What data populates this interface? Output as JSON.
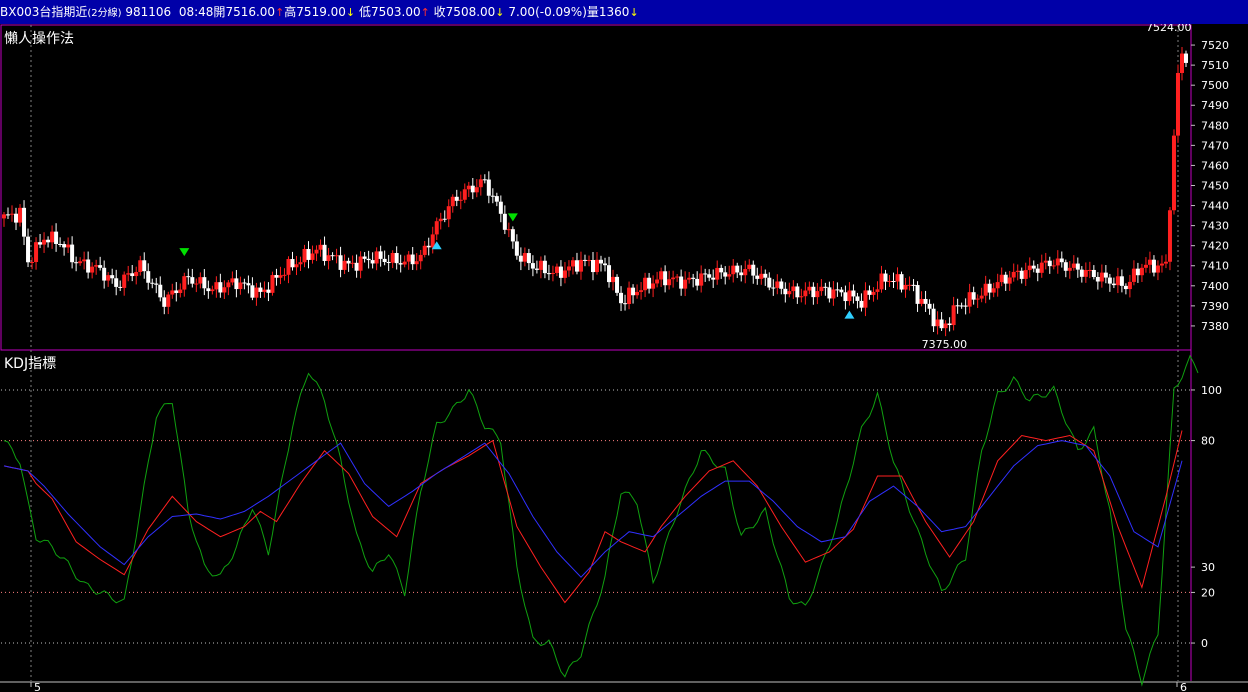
{
  "header": {
    "symbol": "BX003",
    "name": "台指期近",
    "interval": "(2分線)",
    "date": "981106",
    "time": "08:48",
    "open_label": "開",
    "open": "7516.00",
    "high_label": "高",
    "high": "7519.00",
    "low_label": "低",
    "low": "7503.00",
    "close_label": "收",
    "close": "7508.00",
    "change": "7.00",
    "change_pct": "(-0.09%)",
    "volume_label": "量",
    "volume": "1360"
  },
  "colors": {
    "title_bg": "#0000a8",
    "up_candle": "#ff2020",
    "down_candle": "#ffffff",
    "k_line": "#ff2020",
    "d_line": "#3030ff",
    "j_line": "#10a010",
    "panel_border": "#c000c0",
    "buy_marker": "#30d0ff",
    "sell_marker": "#00e000"
  },
  "price_panel": {
    "title": "懶人操作法",
    "high_annotation": "7524.00",
    "low_annotation": "7375.00"
  },
  "kdj_panel": {
    "title": "KDJ指標"
  },
  "x_axis": {
    "labels": [
      "5",
      "6"
    ]
  },
  "chart_data": [
    {
      "type": "candlestick",
      "title": "懶人操作法",
      "ylim": [
        7368,
        7530
      ],
      "y_ticks": [
        7380,
        7390,
        7400,
        7410,
        7420,
        7430,
        7440,
        7450,
        7460,
        7470,
        7480,
        7490,
        7500,
        7510,
        7520
      ],
      "grid": false,
      "annotations": [
        {
          "text": "7524.00",
          "value": 7524
        },
        {
          "text": "7375.00",
          "value": 7375
        }
      ],
      "close_anchors": [
        [
          0,
          7434
        ],
        [
          4,
          7436
        ],
        [
          6,
          7412
        ],
        [
          10,
          7424
        ],
        [
          14,
          7422
        ],
        [
          18,
          7412
        ],
        [
          24,
          7408
        ],
        [
          28,
          7400
        ],
        [
          34,
          7410
        ],
        [
          40,
          7392
        ],
        [
          46,
          7404
        ],
        [
          52,
          7398
        ],
        [
          58,
          7402
        ],
        [
          64,
          7396
        ],
        [
          70,
          7408
        ],
        [
          78,
          7418
        ],
        [
          86,
          7410
        ],
        [
          92,
          7414
        ],
        [
          100,
          7412
        ],
        [
          104,
          7414
        ],
        [
          108,
          7430
        ],
        [
          112,
          7442
        ],
        [
          116,
          7448
        ],
        [
          120,
          7452
        ],
        [
          124,
          7436
        ],
        [
          128,
          7416
        ],
        [
          132,
          7410
        ],
        [
          138,
          7406
        ],
        [
          144,
          7412
        ],
        [
          150,
          7410
        ],
        [
          154,
          7392
        ],
        [
          158,
          7398
        ],
        [
          164,
          7404
        ],
        [
          170,
          7402
        ],
        [
          178,
          7406
        ],
        [
          186,
          7408
        ],
        [
          192,
          7400
        ],
        [
          198,
          7396
        ],
        [
          204,
          7398
        ],
        [
          210,
          7396
        ],
        [
          214,
          7392
        ],
        [
          220,
          7404
        ],
        [
          226,
          7400
        ],
        [
          230,
          7390
        ],
        [
          234,
          7378
        ],
        [
          238,
          7390
        ],
        [
          244,
          7396
        ],
        [
          250,
          7404
        ],
        [
          256,
          7408
        ],
        [
          262,
          7412
        ],
        [
          268,
          7408
        ],
        [
          274,
          7404
        ],
        [
          280,
          7400
        ],
        [
          284,
          7410
        ],
        [
          290,
          7410
        ],
        [
          293,
          7505
        ],
        [
          294,
          7515
        ]
      ],
      "markers": [
        {
          "index": 45,
          "type": "sell"
        },
        {
          "index": 108,
          "type": "buy"
        },
        {
          "index": 127,
          "type": "sell"
        },
        {
          "index": 211,
          "type": "buy"
        }
      ]
    },
    {
      "type": "line",
      "title": "KDJ指標",
      "ylim": [
        -15,
        115
      ],
      "y_ticks": [
        0,
        20,
        30,
        80,
        100
      ],
      "reference_lines": [
        0,
        20,
        80,
        100
      ],
      "anchors": {
        "K": [
          [
            0,
            70
          ],
          [
            6,
            68
          ],
          [
            8,
            63
          ],
          [
            12,
            57
          ],
          [
            18,
            40
          ],
          [
            24,
            33
          ],
          [
            30,
            27
          ],
          [
            36,
            45
          ],
          [
            42,
            58
          ],
          [
            48,
            48
          ],
          [
            54,
            42
          ],
          [
            60,
            46
          ],
          [
            64,
            52
          ],
          [
            68,
            48
          ],
          [
            74,
            63
          ],
          [
            80,
            76
          ],
          [
            86,
            67
          ],
          [
            92,
            50
          ],
          [
            98,
            42
          ],
          [
            104,
            63
          ],
          [
            110,
            69
          ],
          [
            116,
            74
          ],
          [
            122,
            80
          ],
          [
            128,
            46
          ],
          [
            134,
            30
          ],
          [
            140,
            16
          ],
          [
            146,
            28
          ],
          [
            150,
            44
          ],
          [
            154,
            40
          ],
          [
            160,
            36
          ],
          [
            164,
            46
          ],
          [
            170,
            58
          ],
          [
            176,
            68
          ],
          [
            182,
            72
          ],
          [
            188,
            62
          ],
          [
            194,
            46
          ],
          [
            200,
            32
          ],
          [
            206,
            36
          ],
          [
            212,
            45
          ],
          [
            218,
            66
          ],
          [
            224,
            66
          ],
          [
            230,
            48
          ],
          [
            236,
            34
          ],
          [
            242,
            48
          ],
          [
            248,
            72
          ],
          [
            254,
            82
          ],
          [
            260,
            80
          ],
          [
            266,
            82
          ],
          [
            272,
            76
          ],
          [
            278,
            46
          ],
          [
            284,
            22
          ],
          [
            290,
            58
          ],
          [
            294,
            84
          ]
        ],
        "D": [
          [
            0,
            70
          ],
          [
            6,
            68
          ],
          [
            10,
            62
          ],
          [
            16,
            51
          ],
          [
            24,
            38
          ],
          [
            30,
            31
          ],
          [
            36,
            42
          ],
          [
            42,
            50
          ],
          [
            48,
            51
          ],
          [
            54,
            49
          ],
          [
            60,
            52
          ],
          [
            66,
            58
          ],
          [
            72,
            65
          ],
          [
            78,
            72
          ],
          [
            84,
            79
          ],
          [
            90,
            63
          ],
          [
            96,
            54
          ],
          [
            102,
            60
          ],
          [
            108,
            67
          ],
          [
            114,
            73
          ],
          [
            120,
            79
          ],
          [
            126,
            67
          ],
          [
            132,
            50
          ],
          [
            138,
            36
          ],
          [
            144,
            26
          ],
          [
            150,
            36
          ],
          [
            156,
            44
          ],
          [
            162,
            42
          ],
          [
            168,
            50
          ],
          [
            174,
            58
          ],
          [
            180,
            64
          ],
          [
            186,
            64
          ],
          [
            192,
            56
          ],
          [
            198,
            46
          ],
          [
            204,
            40
          ],
          [
            210,
            42
          ],
          [
            216,
            56
          ],
          [
            222,
            62
          ],
          [
            228,
            54
          ],
          [
            234,
            44
          ],
          [
            240,
            46
          ],
          [
            246,
            58
          ],
          [
            252,
            70
          ],
          [
            258,
            78
          ],
          [
            264,
            80
          ],
          [
            270,
            78
          ],
          [
            276,
            66
          ],
          [
            282,
            44
          ],
          [
            288,
            38
          ],
          [
            294,
            72
          ]
        ],
        "J": [
          [
            0,
            80
          ],
          [
            4,
            72
          ],
          [
            6,
            55
          ],
          [
            8,
            42
          ],
          [
            12,
            38
          ],
          [
            16,
            31
          ],
          [
            20,
            23
          ],
          [
            24,
            20
          ],
          [
            30,
            16
          ],
          [
            34,
            52
          ],
          [
            38,
            90
          ],
          [
            42,
            96
          ],
          [
            46,
            52
          ],
          [
            50,
            30
          ],
          [
            54,
            26
          ],
          [
            58,
            38
          ],
          [
            62,
            54
          ],
          [
            66,
            36
          ],
          [
            72,
            86
          ],
          [
            76,
            108
          ],
          [
            80,
            96
          ],
          [
            84,
            72
          ],
          [
            88,
            42
          ],
          [
            92,
            28
          ],
          [
            96,
            36
          ],
          [
            100,
            20
          ],
          [
            104,
            60
          ],
          [
            108,
            86
          ],
          [
            112,
            92
          ],
          [
            116,
            100
          ],
          [
            120,
            86
          ],
          [
            124,
            80
          ],
          [
            128,
            30
          ],
          [
            132,
            1
          ],
          [
            136,
            0
          ],
          [
            140,
            -13
          ],
          [
            144,
            -4
          ],
          [
            150,
            26
          ],
          [
            154,
            60
          ],
          [
            158,
            56
          ],
          [
            162,
            24
          ],
          [
            168,
            52
          ],
          [
            174,
            76
          ],
          [
            180,
            68
          ],
          [
            184,
            42
          ],
          [
            190,
            52
          ],
          [
            196,
            18
          ],
          [
            200,
            14
          ],
          [
            204,
            30
          ],
          [
            208,
            48
          ],
          [
            214,
            84
          ],
          [
            218,
            98
          ],
          [
            222,
            72
          ],
          [
            228,
            44
          ],
          [
            234,
            20
          ],
          [
            240,
            34
          ],
          [
            244,
            76
          ],
          [
            248,
            98
          ],
          [
            252,
            104
          ],
          [
            256,
            96
          ],
          [
            262,
            100
          ],
          [
            268,
            76
          ],
          [
            272,
            84
          ],
          [
            276,
            52
          ],
          [
            280,
            6
          ],
          [
            284,
            -15
          ],
          [
            288,
            4
          ],
          [
            292,
            100
          ],
          [
            296,
            112
          ],
          [
            298,
            108
          ]
        ]
      }
    }
  ]
}
